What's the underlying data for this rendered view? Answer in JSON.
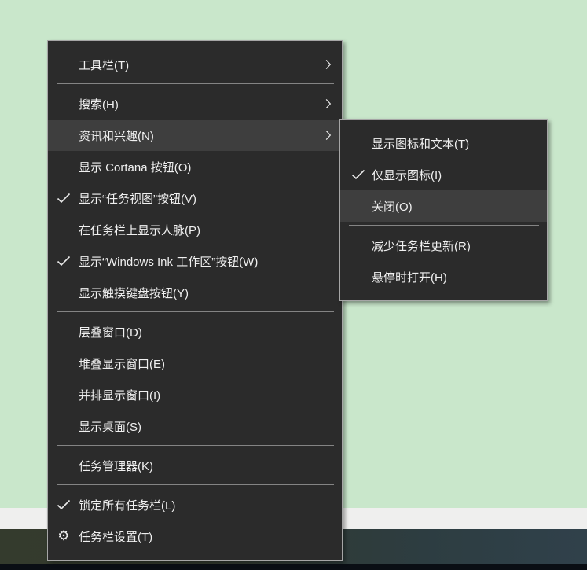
{
  "desktop": {
    "colors": {
      "wallpaper_green": "#c9e7cb",
      "band_white": "#efefee",
      "band_dark_left": "#343b2d",
      "band_dark_right": "#30414b",
      "taskbar_strip": "#0a0e14"
    }
  },
  "menu_style": {
    "background": "#2b2b2b",
    "highlight": "#3e3e3e",
    "border": "#a6a6a6",
    "text": "#f0f0f0",
    "separator": "#848484"
  },
  "icons": {
    "gear_glyph": "⚙",
    "check_name": "check-icon",
    "chevron_name": "chevron-right-icon",
    "gear_name": "gear-icon"
  },
  "main_menu": {
    "items": [
      {
        "id": "toolbars",
        "label": "工具栏(T)",
        "arrow": true
      },
      {
        "id": "sep-1",
        "separator": true
      },
      {
        "id": "search",
        "label": "搜索(H)",
        "arrow": true
      },
      {
        "id": "news-and-interests",
        "label": "资讯和兴趣(N)",
        "arrow": true,
        "highlighted": true
      },
      {
        "id": "show-cortana-button",
        "label": "显示 Cortana 按钮(O)"
      },
      {
        "id": "show-task-view-button",
        "label": "显示“任务视图”按钮(V)",
        "checked": true
      },
      {
        "id": "show-people-on-taskbar",
        "label": "在任务栏上显示人脉(P)"
      },
      {
        "id": "show-windows-ink-workspace-button",
        "label": "显示“Windows Ink 工作区”按钮(W)",
        "checked": true
      },
      {
        "id": "show-touch-keyboard-button",
        "label": "显示触摸键盘按钮(Y)"
      },
      {
        "id": "sep-2",
        "separator": true
      },
      {
        "id": "cascade-windows",
        "label": "层叠窗口(D)"
      },
      {
        "id": "show-windows-stacked",
        "label": "堆叠显示窗口(E)"
      },
      {
        "id": "show-windows-side-by-side",
        "label": "并排显示窗口(I)"
      },
      {
        "id": "show-desktop",
        "label": "显示桌面(S)"
      },
      {
        "id": "sep-3",
        "separator": true
      },
      {
        "id": "task-manager",
        "label": "任务管理器(K)"
      },
      {
        "id": "sep-4",
        "separator": true
      },
      {
        "id": "lock-all-taskbars",
        "label": "锁定所有任务栏(L)",
        "checked": true
      },
      {
        "id": "taskbar-settings",
        "label": "任务栏设置(T)",
        "gear": true
      }
    ]
  },
  "sub_menu": {
    "items": [
      {
        "id": "show-icon-and-text",
        "label": "显示图标和文本(T)"
      },
      {
        "id": "show-icon-only",
        "label": "仅显示图标(I)",
        "checked": true
      },
      {
        "id": "turn-off",
        "label": "关闭(O)",
        "highlighted": true
      },
      {
        "id": "sep-1",
        "separator": true
      },
      {
        "id": "reduce-taskbar-updates",
        "label": "减少任务栏更新(R)"
      },
      {
        "id": "open-on-hover",
        "label": "悬停时打开(H)"
      }
    ]
  }
}
